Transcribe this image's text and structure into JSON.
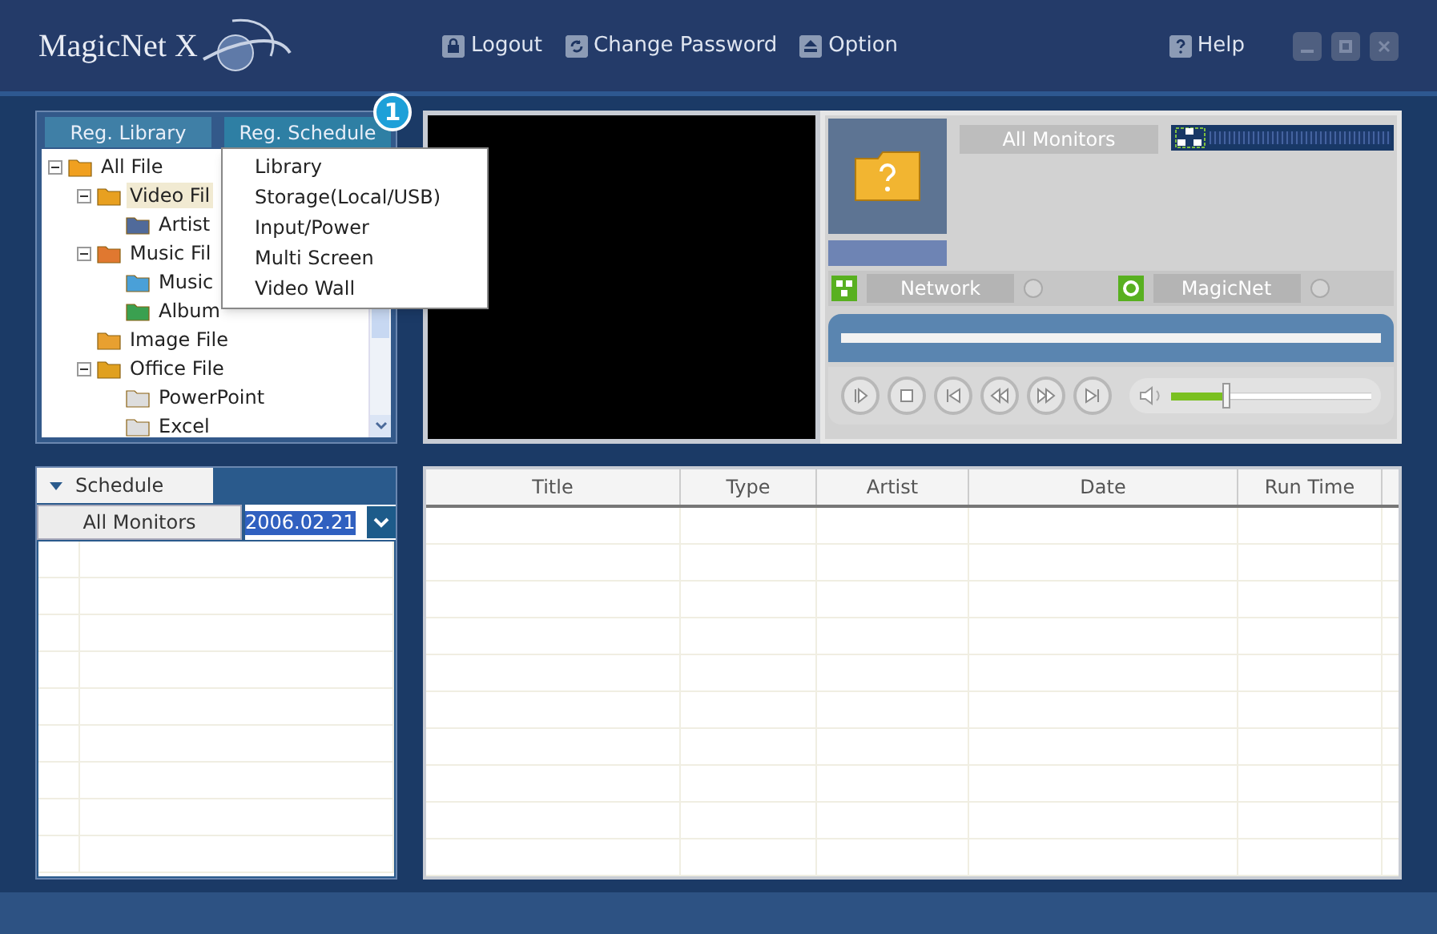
{
  "app": {
    "logo": "MagicNet X"
  },
  "toolbar": [
    {
      "kind": "lock",
      "label": "Logout"
    },
    {
      "kind": "refresh",
      "label": "Change Password"
    },
    {
      "kind": "option",
      "label": "Option"
    },
    {
      "kind": "help",
      "label": "Help"
    }
  ],
  "library_tabs": [
    {
      "label": "Reg. Library",
      "selected": false
    },
    {
      "label": "Reg. Schedule",
      "selected": true
    }
  ],
  "step_badge": "1",
  "tree": [
    {
      "label": "All File",
      "kind": "all",
      "expanded": true,
      "selected": false,
      "children": [
        {
          "label": "Video Fil",
          "kind": "video",
          "expanded": true,
          "selected": true,
          "children": [
            {
              "label": "Artist",
              "kind": "clip",
              "selected": false
            }
          ]
        },
        {
          "label": "Music Fil",
          "kind": "music",
          "expanded": true,
          "selected": false,
          "children": [
            {
              "label": "Music",
              "kind": "note",
              "selected": false
            },
            {
              "label": "Album",
              "kind": "globe",
              "selected": false
            }
          ]
        },
        {
          "label": "Image File",
          "kind": "image",
          "selected": false
        },
        {
          "label": "Office File",
          "kind": "office",
          "expanded": true,
          "selected": false,
          "children": [
            {
              "label": "PowerPoint",
              "kind": "doc",
              "selected": false
            },
            {
              "label": "Excel",
              "kind": "doc",
              "selected": false
            }
          ]
        }
      ]
    }
  ],
  "popup_menu": [
    "Library",
    "Storage(Local/USB)",
    "Input/Power",
    "Multi Screen",
    "Video Wall"
  ],
  "monitor_panel": {
    "label": "All Monitors",
    "indicators": [
      {
        "kind": "network",
        "label": "Network"
      },
      {
        "kind": "magicnet",
        "label": "MagicNet"
      }
    ],
    "volume": {
      "level": 0.27
    }
  },
  "schedule": {
    "tab": "Schedule",
    "monitor_button": "All Monitors",
    "date": "2006.02.21"
  },
  "table": {
    "columns": [
      "Title",
      "Type",
      "Artist",
      "Date",
      "Run Time"
    ]
  }
}
